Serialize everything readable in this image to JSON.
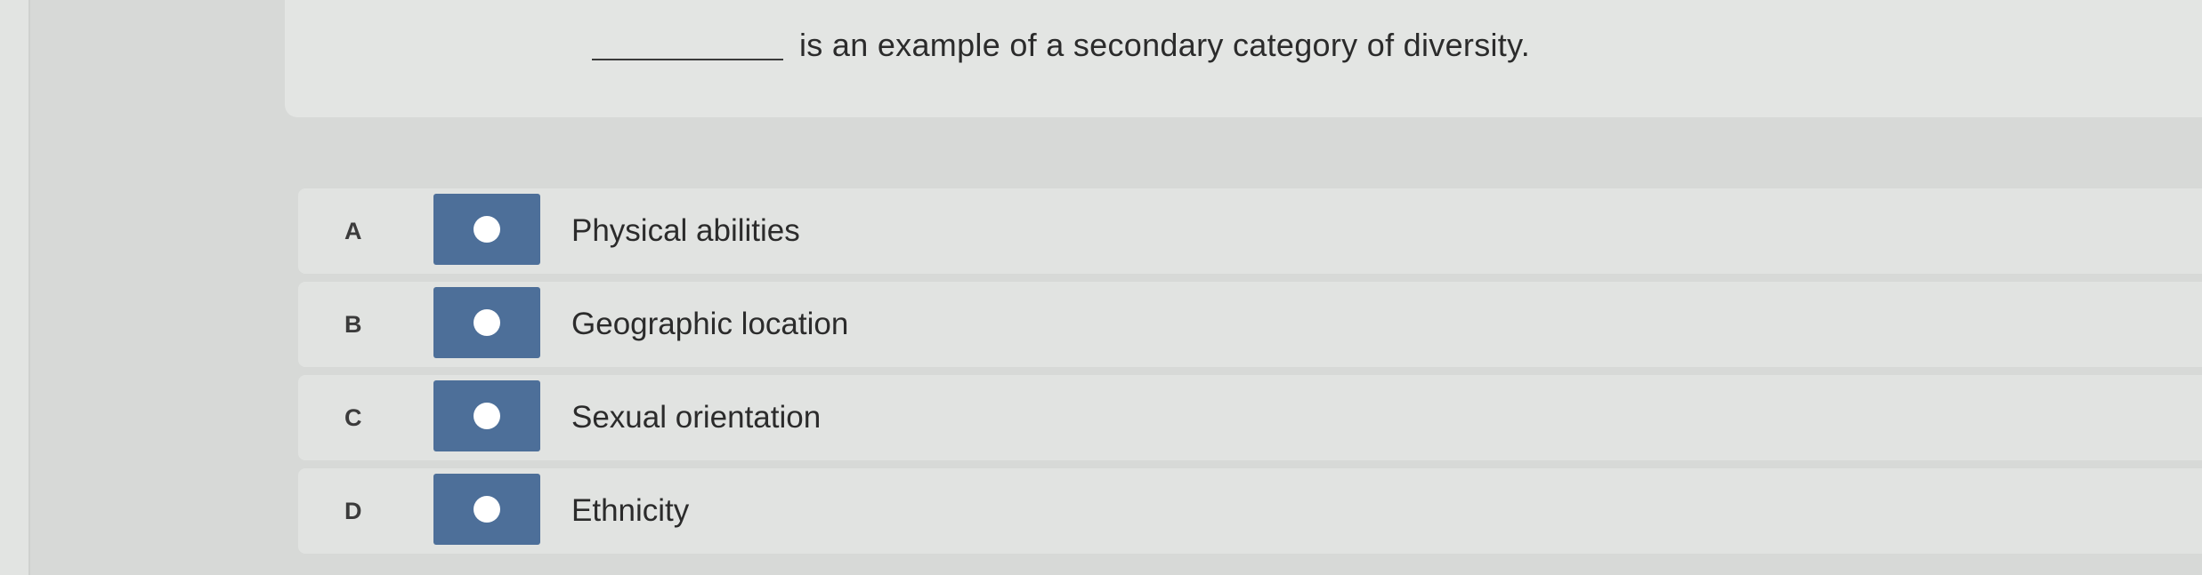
{
  "question": {
    "text": "is an example of a secondary category of diversity."
  },
  "options": [
    {
      "letter": "A",
      "label": "Physical abilities"
    },
    {
      "letter": "B",
      "label": "Geographic location"
    },
    {
      "letter": "C",
      "label": "Sexual orientation"
    },
    {
      "letter": "D",
      "label": "Ethnicity"
    }
  ],
  "colors": {
    "radio_button": "#4d6f99",
    "background": "#d7d9d7",
    "panel": "#e1e3e1"
  }
}
